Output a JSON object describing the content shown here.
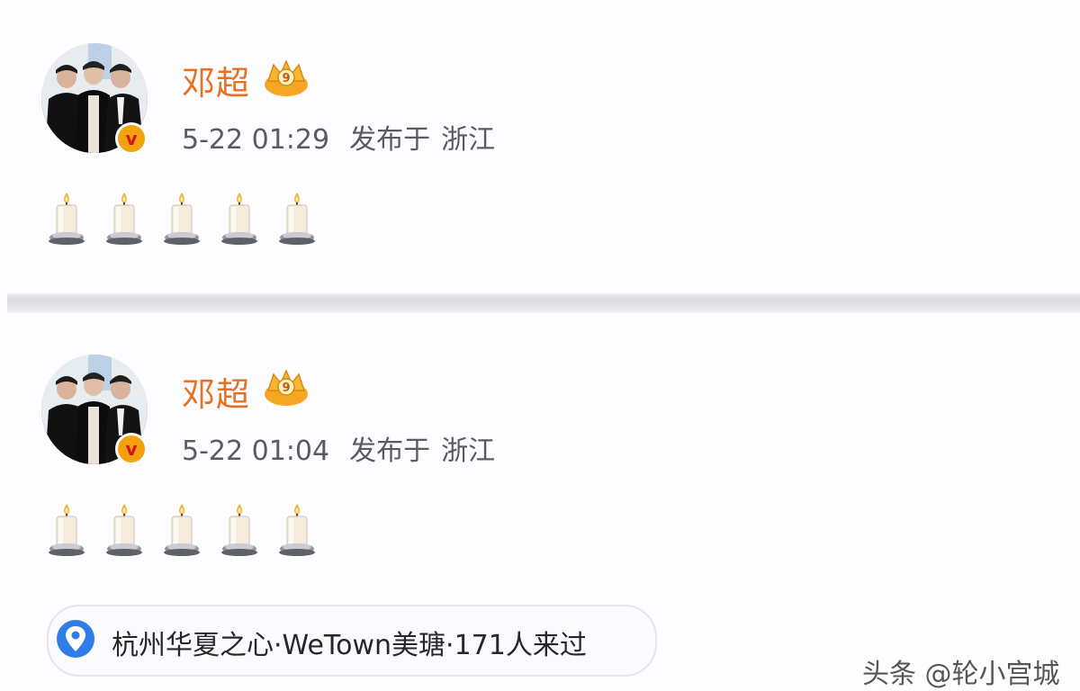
{
  "posts": [
    {
      "author": "邓超",
      "verified_mark": "v",
      "crown_level": "9",
      "time": "5-22 01:29",
      "published_label": "发布于",
      "region": "浙江",
      "content_emoji": [
        "candle-emoji",
        "candle-emoji",
        "candle-emoji",
        "candle-emoji",
        "candle-emoji"
      ]
    },
    {
      "author": "邓超",
      "verified_mark": "v",
      "crown_level": "9",
      "time": "5-22 01:04",
      "published_label": "发布于",
      "region": "浙江",
      "content_emoji": [
        "candle-emoji",
        "candle-emoji",
        "candle-emoji",
        "candle-emoji",
        "candle-emoji"
      ],
      "location": {
        "text": "杭州华夏之心·WeTown美瑭·171人来过",
        "icon": "location-pin-icon"
      }
    }
  ],
  "watermark": "头条 @轮小宫城",
  "colors": {
    "name": "#e96f22",
    "badge": "#f1a20d",
    "pin": "#2e7de8"
  }
}
